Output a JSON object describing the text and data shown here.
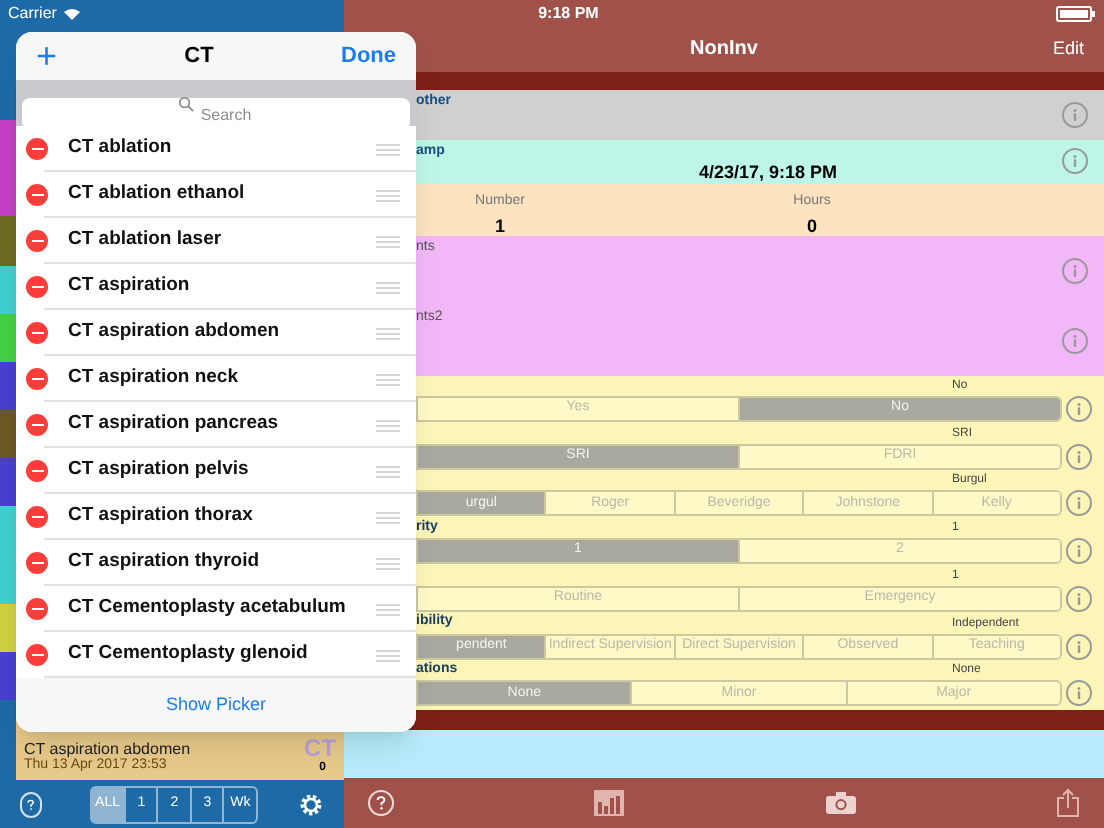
{
  "status_bar": {
    "carrier": "Carrier",
    "time": "9:18 PM"
  },
  "left_pane": {
    "list_item": {
      "title": "CT aspiration abdomen",
      "date": "Thu 13 Apr 2017  23:53",
      "badge": "CT",
      "badge_count": "0"
    },
    "toolbar": {
      "filters": [
        {
          "label": "ALL",
          "selected": true
        },
        {
          "label": "1",
          "selected": false
        },
        {
          "label": "2",
          "selected": false
        },
        {
          "label": "3",
          "selected": false
        },
        {
          "label": "Wk",
          "selected": false
        }
      ]
    }
  },
  "popover": {
    "add": "+",
    "title": "CT",
    "done": "Done",
    "search": {
      "placeholder": "Search"
    },
    "items": [
      "CT ablation",
      "CT ablation ethanol",
      "CT ablation laser",
      "CT aspiration",
      "CT aspiration abdomen",
      "CT aspiration neck",
      "CT aspiration pancreas",
      "CT aspiration pelvis",
      "CT aspiration thorax",
      "CT aspiration thyroid",
      "CT Cementoplasty acetabulum",
      "CT Cementoplasty glenoid"
    ],
    "footer": "Show Picker"
  },
  "detail": {
    "title": "NonInv",
    "edit": "Edit",
    "fields": [
      {
        "kind": "text",
        "label": "other",
        "color": "#d0d0d0"
      },
      {
        "kind": "date",
        "label": "amp",
        "value": "4/23/17, 9:18 PM",
        "color": "#bdf5e6"
      },
      {
        "kind": "pair",
        "color": "#fbe3c0",
        "items": [
          {
            "label": "Number",
            "value": "1"
          },
          {
            "label": "Hours",
            "value": "0"
          }
        ]
      },
      {
        "kind": "text",
        "label": "nts",
        "color": "#f2b7f7"
      },
      {
        "kind": "text",
        "label": "nts2",
        "color": "#f2b7f7"
      }
    ],
    "segments": [
      {
        "value": "No",
        "options": [
          {
            "label": "Yes",
            "selected": false
          },
          {
            "label": "No",
            "selected": true
          }
        ]
      },
      {
        "value": "SRI",
        "options": [
          {
            "label": "SRI",
            "selected": true
          },
          {
            "label": "FDRI",
            "selected": false
          }
        ]
      },
      {
        "value": "Burgul",
        "options": [
          {
            "label": "urgul",
            "selected": true
          },
          {
            "label": "Roger",
            "selected": false
          },
          {
            "label": "Beveridge",
            "selected": false
          },
          {
            "label": "Johnstone",
            "selected": false
          },
          {
            "label": "Kelly",
            "selected": false
          }
        ]
      },
      {
        "label": "rity",
        "value": "1",
        "options": [
          {
            "label": "1",
            "selected": true
          },
          {
            "label": "2",
            "selected": false
          }
        ]
      },
      {
        "value": "1",
        "options": [
          {
            "label": "Routine",
            "selected": false
          },
          {
            "label": "Emergency",
            "selected": false
          }
        ]
      },
      {
        "label": "ibility",
        "value": "Independent",
        "options": [
          {
            "label": "pendent",
            "selected": true
          },
          {
            "label": "Indirect Supervision",
            "selected": false
          },
          {
            "label": "Direct Supervision",
            "selected": false
          },
          {
            "label": "Observed",
            "selected": false
          },
          {
            "label": "Teaching",
            "selected": false
          }
        ]
      },
      {
        "label": "ations",
        "value": "None",
        "options": [
          {
            "label": "None",
            "selected": true
          },
          {
            "label": "Minor",
            "selected": false
          },
          {
            "label": "Major",
            "selected": false
          }
        ]
      }
    ]
  }
}
